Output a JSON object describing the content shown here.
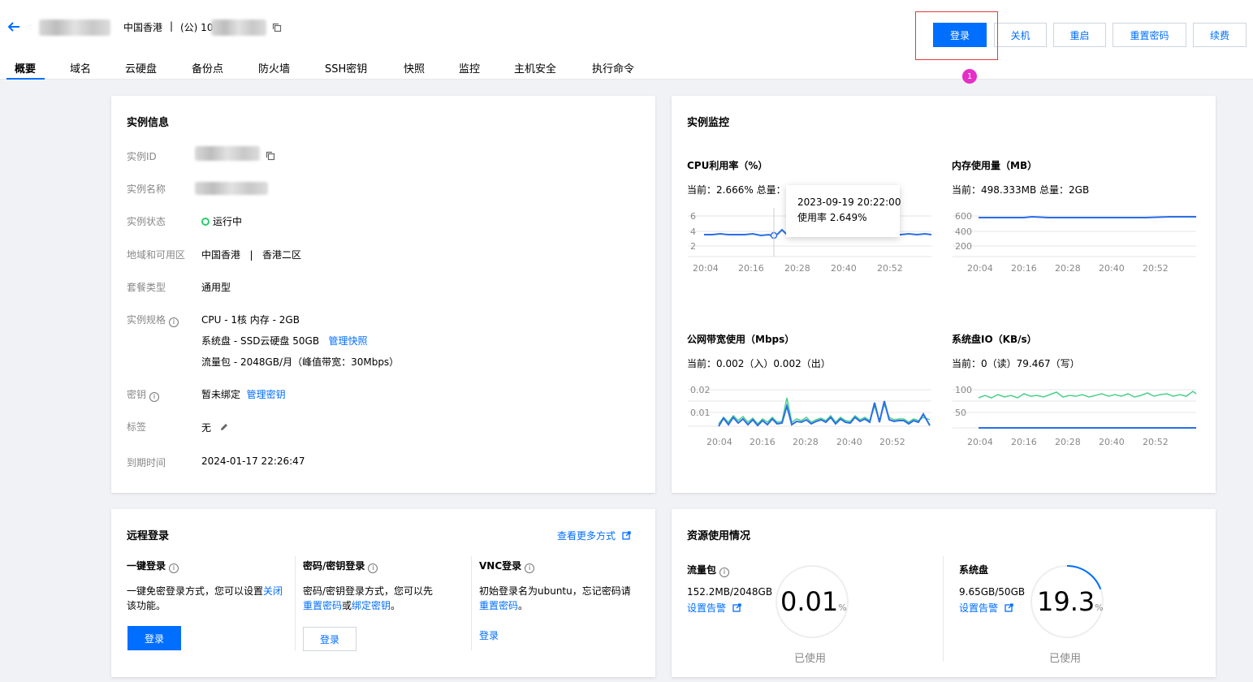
{
  "header": {
    "region": "中国香港",
    "separator": "|",
    "ip_prefix": "(公) 10"
  },
  "tabs": [
    "概要",
    "域名",
    "云硬盘",
    "备份点",
    "防火墙",
    "SSH密钥",
    "快照",
    "监控",
    "主机安全",
    "执行命令"
  ],
  "actions": {
    "login": "登录",
    "shutdown": "关机",
    "restart": "重启",
    "reset_password": "重置密码",
    "renew": "续费",
    "marker": "1"
  },
  "instance_info": {
    "title": "实例信息",
    "labels": {
      "id": "实例ID",
      "name": "实例名称",
      "status": "实例状态",
      "region": "地域和可用区",
      "package": "套餐类型",
      "spec": "实例规格",
      "key": "密钥",
      "tag": "标签",
      "expire": "到期时间"
    },
    "status": "运行中",
    "region_value": "中国香港",
    "region_sep": "|",
    "zone_value": "香港二区",
    "package_value": "通用型",
    "spec_cpu": "CPU - 1核 内存 - 2GB",
    "spec_disk": "系统盘 - SSD云硬盘 50GB",
    "spec_disk_link": "管理快照",
    "spec_traffic": "流量包 - 2048GB/月（峰值带宽：30Mbps）",
    "key_value": "暂未绑定",
    "key_link": "管理密钥",
    "tag_value": "无",
    "expire_value": "2024-01-17 22:26:47"
  },
  "monitor": {
    "title": "实例监控",
    "cpu": {
      "title": "CPU利用率（%）",
      "current": "当前：2.666% 总量：1",
      "y_ticks": [
        "6",
        "4",
        "2"
      ],
      "x_ticks": [
        "20:04",
        "20:16",
        "20:28",
        "20:40",
        "20:52"
      ]
    },
    "memory": {
      "title": "内存使用量（MB）",
      "current": "当前：498.333MB 总量：2GB",
      "y_ticks": [
        "600",
        "400",
        "200"
      ],
      "x_ticks": [
        "20:04",
        "20:16",
        "20:28",
        "20:40",
        "20:52"
      ]
    },
    "bandwidth": {
      "title": "公网带宽使用（Mbps）",
      "current": "当前：0.002（入）0.002（出）",
      "y_ticks": [
        "0.02",
        "0.01"
      ],
      "x_ticks": [
        "20:04",
        "20:16",
        "20:28",
        "20:40",
        "20:52"
      ]
    },
    "disk_io": {
      "title": "系统盘IO（KB/s）",
      "current": "当前：0（读）79.467（写）",
      "y_ticks": [
        "100",
        "50"
      ],
      "x_ticks": [
        "20:04",
        "20:16",
        "20:28",
        "20:40",
        "20:52"
      ]
    },
    "tooltip": {
      "time": "2023-09-19 20:22:00",
      "value": "使用率 2.649%"
    },
    "colors": {
      "blue": "#2a6ee8",
      "green": "#4bd08c"
    }
  },
  "remote_login": {
    "title": "远程登录",
    "more": "查看更多方式",
    "one_click": {
      "title": "一键登录",
      "desc_1": "一键免密登录方式，您可以设置",
      "desc_link": "关闭",
      "desc_2": "该功能。",
      "button": "登录"
    },
    "password": {
      "title": "密码/密钥登录",
      "desc_1": "密码/密钥登录方式，您可以先",
      "link_1": "重置密码",
      "or": "或",
      "link_2": "绑定密钥",
      "end": "。",
      "button": "登录"
    },
    "vnc": {
      "title": "VNC登录",
      "desc_1": "初始登录名为ubuntu，忘记密码请",
      "link": "重置密码",
      "end": "。",
      "button": "登录"
    }
  },
  "resources": {
    "title": "资源使用情况",
    "traffic": {
      "title": "流量包",
      "usage": "152.2MB/2048GB",
      "alert": "设置告警",
      "value": "0.01",
      "unit": "%",
      "label": "已使用",
      "fraction": 0.0001
    },
    "disk": {
      "title": "系统盘",
      "usage": "9.65GB/50GB",
      "alert": "设置告警",
      "value": "19.3",
      "unit": "%",
      "label": "已使用",
      "fraction": 0.193
    }
  }
}
